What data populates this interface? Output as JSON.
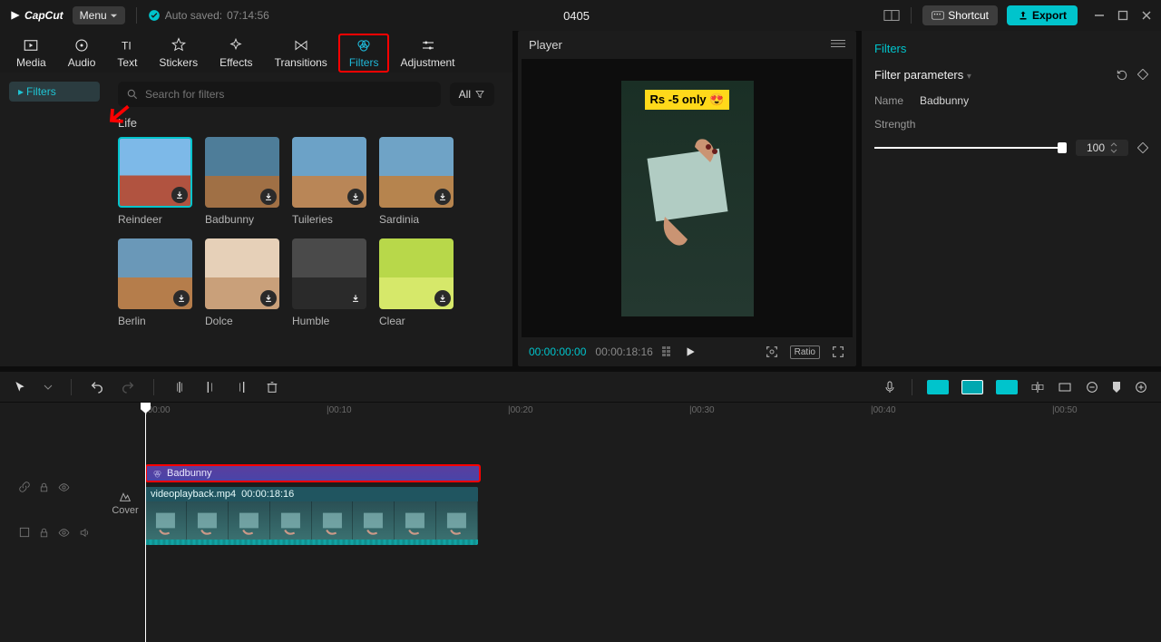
{
  "app": {
    "name": "CapCut",
    "menu_label": "Menu",
    "autosave_prefix": "Auto saved:",
    "autosave_time": "07:14:56",
    "project_title": "0405"
  },
  "titlebar_buttons": {
    "shortcut": "Shortcut",
    "export": "Export"
  },
  "tabs": [
    {
      "label": "Media"
    },
    {
      "label": "Audio"
    },
    {
      "label": "Text"
    },
    {
      "label": "Stickers"
    },
    {
      "label": "Effects"
    },
    {
      "label": "Transitions"
    },
    {
      "label": "Filters"
    },
    {
      "label": "Adjustment"
    }
  ],
  "sidebar": {
    "active": "Filters"
  },
  "search": {
    "placeholder": "Search for filters",
    "all_label": "All"
  },
  "filter_section": {
    "title": "Life",
    "items": [
      {
        "name": "Reindeer",
        "selected": true,
        "c1": "#7db9e8",
        "c2": "#b15340"
      },
      {
        "name": "Badbunny",
        "c1": "#4e7d99",
        "c2": "#a07045"
      },
      {
        "name": "Tuileries",
        "c1": "#6ca2c7",
        "c2": "#b98657"
      },
      {
        "name": "Sardinia",
        "c1": "#6fa3c6",
        "c2": "#b6844e"
      },
      {
        "name": "Berlin",
        "c1": "#6a98b8",
        "c2": "#b57d4b"
      },
      {
        "name": "Dolce",
        "c1": "#e6d0b8",
        "c2": "#c9a07a"
      },
      {
        "name": "Humble",
        "c1": "#4a4a4a",
        "c2": "#2a2a2a"
      },
      {
        "name": "Clear",
        "c1": "#b8d84a",
        "c2": "#d6e86a"
      }
    ]
  },
  "player": {
    "title": "Player",
    "overlay_text": "Rs -5 only 😍",
    "current_time": "00:00:00:00",
    "total_time": "00:00:18:16",
    "ratio": "Ratio"
  },
  "params": {
    "panel_title": "Filters",
    "heading": "Filter parameters",
    "name_label": "Name",
    "name_value": "Badbunny",
    "strength_label": "Strength",
    "strength_value": "100"
  },
  "timeline": {
    "ruler": [
      "00:00",
      "00:10",
      "00:20",
      "00:30",
      "00:40",
      "00:50"
    ],
    "filter_clip_name": "Badbunny",
    "video_clip_name": "videoplayback.mp4",
    "video_clip_time": "00:00:18:16",
    "cover_label": "Cover"
  }
}
